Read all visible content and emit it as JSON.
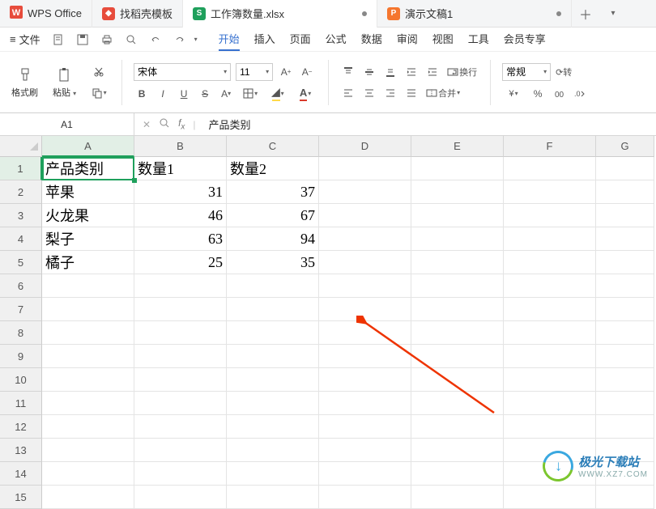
{
  "tabs": {
    "wps": "WPS Office",
    "template": "找稻壳模板",
    "workbook": "工作簿数量.xlsx",
    "presentation": "演示文稿1"
  },
  "menu": {
    "file": "文件",
    "items": [
      "开始",
      "插入",
      "页面",
      "公式",
      "数据",
      "审阅",
      "视图",
      "工具",
      "会员专享"
    ],
    "active": "开始"
  },
  "ribbon": {
    "format_brush": "格式刷",
    "paste": "粘贴",
    "font_name": "宋体",
    "font_size": "11",
    "wrap": "换行",
    "merge": "合并",
    "number_format": "常规",
    "currency_btn": "¥",
    "percent_btn": "%",
    "rotate": "⟳转"
  },
  "namebox": "A1",
  "formula_value": "产品类别",
  "sheet": {
    "cols": [
      "A",
      "B",
      "C",
      "D",
      "E",
      "F",
      "G"
    ],
    "rows": [
      1,
      2,
      3,
      4,
      5,
      6,
      7,
      8,
      9,
      10,
      11,
      12,
      13,
      14,
      15
    ],
    "data": {
      "r1": {
        "A": "产品类别",
        "B": "数量1",
        "C": "数量2"
      },
      "r2": {
        "A": "苹果",
        "B": "31",
        "C": "37"
      },
      "r3": {
        "A": "火龙果",
        "B": "46",
        "C": "67"
      },
      "r4": {
        "A": "梨子",
        "B": "63",
        "C": "94"
      },
      "r5": {
        "A": "橘子",
        "B": "25",
        "C": "35"
      }
    }
  },
  "watermark": {
    "cn": "极光下载站",
    "en": "WWW.XZ7.COM"
  }
}
